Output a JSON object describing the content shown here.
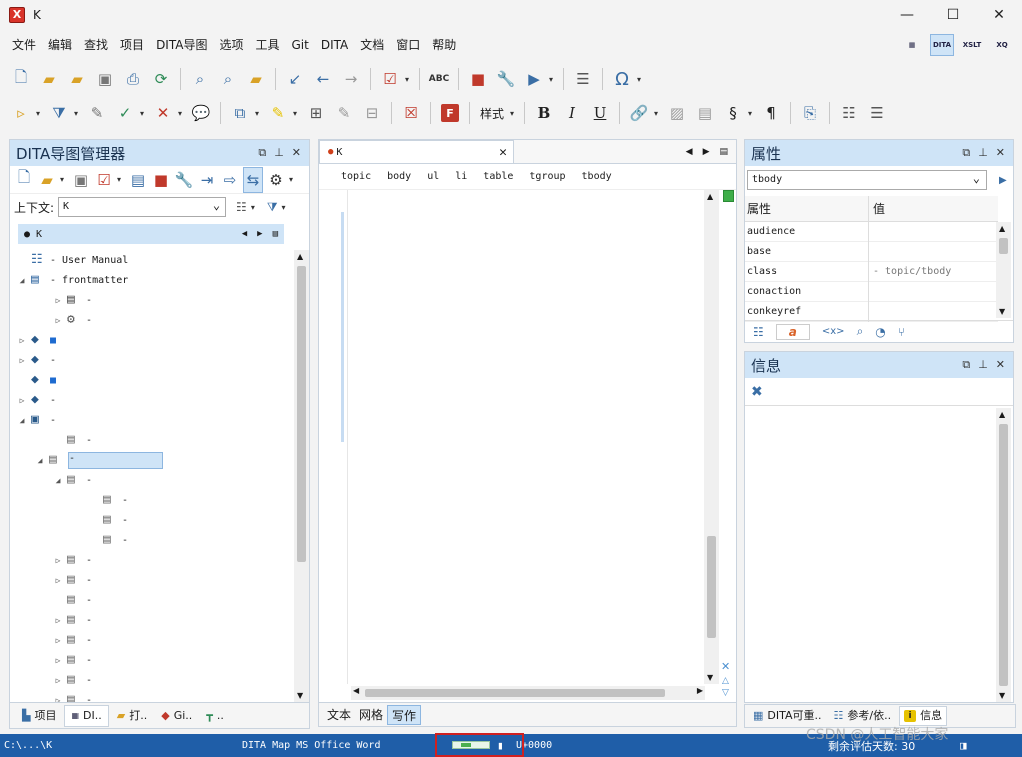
{
  "window": {
    "title": "K",
    "logo": "X"
  },
  "menu": [
    "文件",
    "编辑",
    "查找",
    "项目",
    "DITA导图",
    "选项",
    "工具",
    "Git",
    "DITA",
    "文档",
    "窗口",
    "帮助"
  ],
  "perspectives": [
    {
      "label": "",
      "icon": "table-layout-icon",
      "active": false
    },
    {
      "label": "DITA",
      "icon": "dita-perspective-icon",
      "active": true
    },
    {
      "label": "XSLT",
      "icon": "xslt-perspective-icon",
      "active": false
    },
    {
      "label": "XQ",
      "icon": "xquery-perspective-icon",
      "active": false
    }
  ],
  "toolbar2": {
    "style_label": "样式",
    "bold": "B",
    "italic": "I",
    "underline": "U",
    "section": "§",
    "pilcrow": "¶",
    "omega": "Ω",
    "abc": "ABC"
  },
  "map_manager": {
    "title": "DITA导图管理器",
    "context_label": "上下文:",
    "context_value": "K",
    "map_tab": "● K",
    "tree": [
      {
        "indent": 0,
        "twisty": "",
        "icon": "map-icon",
        "label": "- User Manual"
      },
      {
        "indent": 0,
        "twisty": "◢",
        "icon": "frontmatter-icon",
        "label": "- frontmatter"
      },
      {
        "indent": 2,
        "twisty": "▷",
        "icon": "topic-group-icon",
        "label": "-"
      },
      {
        "indent": 2,
        "twisty": "▷",
        "icon": "topic-set-icon",
        "label": "-"
      },
      {
        "indent": 0,
        "twisty": "▷",
        "icon": "book-icon",
        "label": "■"
      },
      {
        "indent": 0,
        "twisty": "▷",
        "icon": "book-icon",
        "label": "-"
      },
      {
        "indent": 0,
        "twisty": "",
        "icon": "book-icon",
        "label": "■"
      },
      {
        "indent": 0,
        "twisty": "▷",
        "icon": "book-icon",
        "label": "-"
      },
      {
        "indent": 0,
        "twisty": "◢",
        "icon": "open-book-icon",
        "label": "-"
      },
      {
        "indent": 2,
        "twisty": "",
        "icon": "topic-icon",
        "label": "-"
      },
      {
        "indent": 1,
        "twisty": "◢",
        "icon": "topic-icon",
        "label": "-",
        "selected": true
      },
      {
        "indent": 2,
        "twisty": "◢",
        "icon": "topic-icon",
        "label": "-"
      },
      {
        "indent": 4,
        "twisty": "",
        "icon": "topic-icon",
        "label": "-"
      },
      {
        "indent": 4,
        "twisty": "",
        "icon": "topic-icon",
        "label": "-"
      },
      {
        "indent": 4,
        "twisty": "",
        "icon": "topic-icon",
        "label": "-"
      },
      {
        "indent": 2,
        "twisty": "▷",
        "icon": "topic-icon",
        "label": "-"
      },
      {
        "indent": 2,
        "twisty": "▷",
        "icon": "topic-icon",
        "label": "-"
      },
      {
        "indent": 2,
        "twisty": "",
        "icon": "topic-icon",
        "label": "-"
      },
      {
        "indent": 2,
        "twisty": "▷",
        "icon": "topic-icon",
        "label": "-"
      },
      {
        "indent": 2,
        "twisty": "▷",
        "icon": "topic-icon",
        "label": "-"
      },
      {
        "indent": 2,
        "twisty": "▷",
        "icon": "topic-icon",
        "label": "-"
      },
      {
        "indent": 2,
        "twisty": "▷",
        "icon": "topic-icon",
        "label": "-"
      },
      {
        "indent": 2,
        "twisty": "▷",
        "icon": "topic-icon",
        "label": "-"
      }
    ],
    "bottom_tabs": [
      {
        "label": "项目",
        "icon": "project-icon"
      },
      {
        "label": "DI..",
        "icon": "dita-map-icon",
        "active": true
      },
      {
        "label": "打..",
        "icon": "open-files-icon"
      },
      {
        "label": "Gi..",
        "icon": "git-icon"
      },
      {
        "label": "..",
        "icon": "hierarchy-icon"
      }
    ]
  },
  "editor": {
    "tab_title": "K",
    "breadcrumbs": [
      "topic",
      "body",
      "ul",
      "li",
      "table",
      "tgroup",
      "tbody"
    ],
    "mode_tabs": [
      {
        "label": "文本",
        "active": false
      },
      {
        "label": "网格",
        "active": false
      },
      {
        "label": "写作",
        "active": true
      }
    ]
  },
  "attributes": {
    "title": "属性",
    "element": "tbody",
    "col_name": "属性",
    "col_value": "值",
    "rows": [
      {
        "name": "audience",
        "value": ""
      },
      {
        "name": "base",
        "value": ""
      },
      {
        "name": "class",
        "value": "- topic/tbody"
      },
      {
        "name": "conaction",
        "value": ""
      },
      {
        "name": "conkeyref",
        "value": ""
      }
    ]
  },
  "info": {
    "title": "信息"
  },
  "right_bottom_tabs": [
    {
      "label": "DITA可重..",
      "icon": "reusable-icon"
    },
    {
      "label": "参考/依..",
      "icon": "references-icon"
    },
    {
      "label": "信息",
      "icon": "info-icon",
      "active": true
    }
  ],
  "status": {
    "path": "C:\\...\\K",
    "doc_type": "DITA Map MS Office Word",
    "unicode": "U+0000",
    "progress": 0.45,
    "trial": "剩余评估天数: 30",
    "watermark": "CSDN @人工智能大家"
  },
  "colors": {
    "accent": "#cfe4f7",
    "statusbar": "#1f5ea8",
    "highlight_box": "#d02020"
  }
}
